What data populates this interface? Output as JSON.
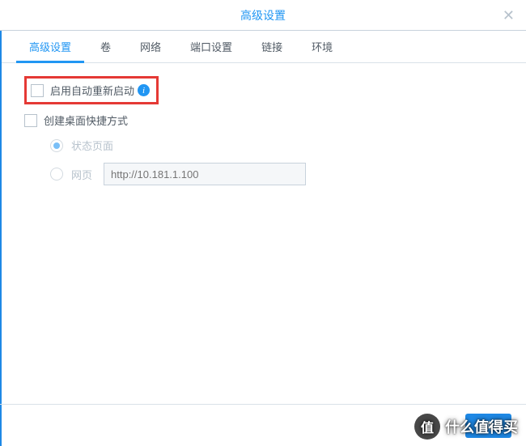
{
  "header": {
    "title": "高级设置"
  },
  "tabs": [
    {
      "label": "高级设置",
      "active": true
    },
    {
      "label": "卷",
      "active": false
    },
    {
      "label": "网络",
      "active": false
    },
    {
      "label": "端口设置",
      "active": false
    },
    {
      "label": "链接",
      "active": false
    },
    {
      "label": "环境",
      "active": false
    }
  ],
  "options": {
    "auto_restart": {
      "label": "启用自动重新启动",
      "checked": false,
      "highlighted": true
    },
    "desktop_shortcut": {
      "label": "创建桌面快捷方式",
      "checked": false
    },
    "radios": {
      "status_page": {
        "label": "状态页面",
        "checked": true
      },
      "web_page": {
        "label": "网页",
        "checked": false,
        "url_placeholder": "http://10.181.1.100"
      }
    }
  },
  "footer": {
    "confirm": "确"
  },
  "watermark": {
    "badge": "值",
    "text": "什么值得买"
  }
}
